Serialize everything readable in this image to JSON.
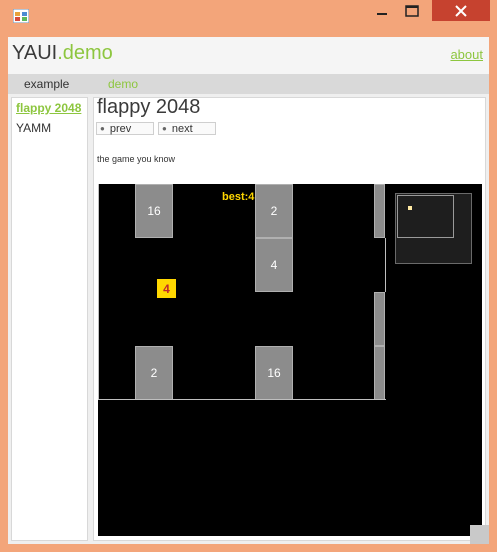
{
  "header": {
    "brand_main": "YAUI",
    "brand_accent": ".demo",
    "about": "about"
  },
  "menu": {
    "items": [
      {
        "label": "example"
      },
      {
        "label": "demo"
      }
    ]
  },
  "sidebar": {
    "items": [
      {
        "label": "flappy 2048",
        "active": true
      },
      {
        "label": "YAMM"
      }
    ]
  },
  "page": {
    "title": "flappy 2048",
    "prev_label": "prev",
    "next_label": "next",
    "subtitle": "the game you know"
  },
  "game": {
    "best": "best:4",
    "bird_value": "4",
    "pipes": [
      {
        "label": "16"
      },
      {
        "label": "2"
      },
      {
        "label": "4"
      },
      {
        "label": "2"
      },
      {
        "label": "16"
      }
    ]
  },
  "colors": {
    "accent": "#8dc63f",
    "close": "#c6422f",
    "bird": "#ffd700",
    "bird_text": "#c0262d",
    "pipe": "#8c8c8c"
  }
}
